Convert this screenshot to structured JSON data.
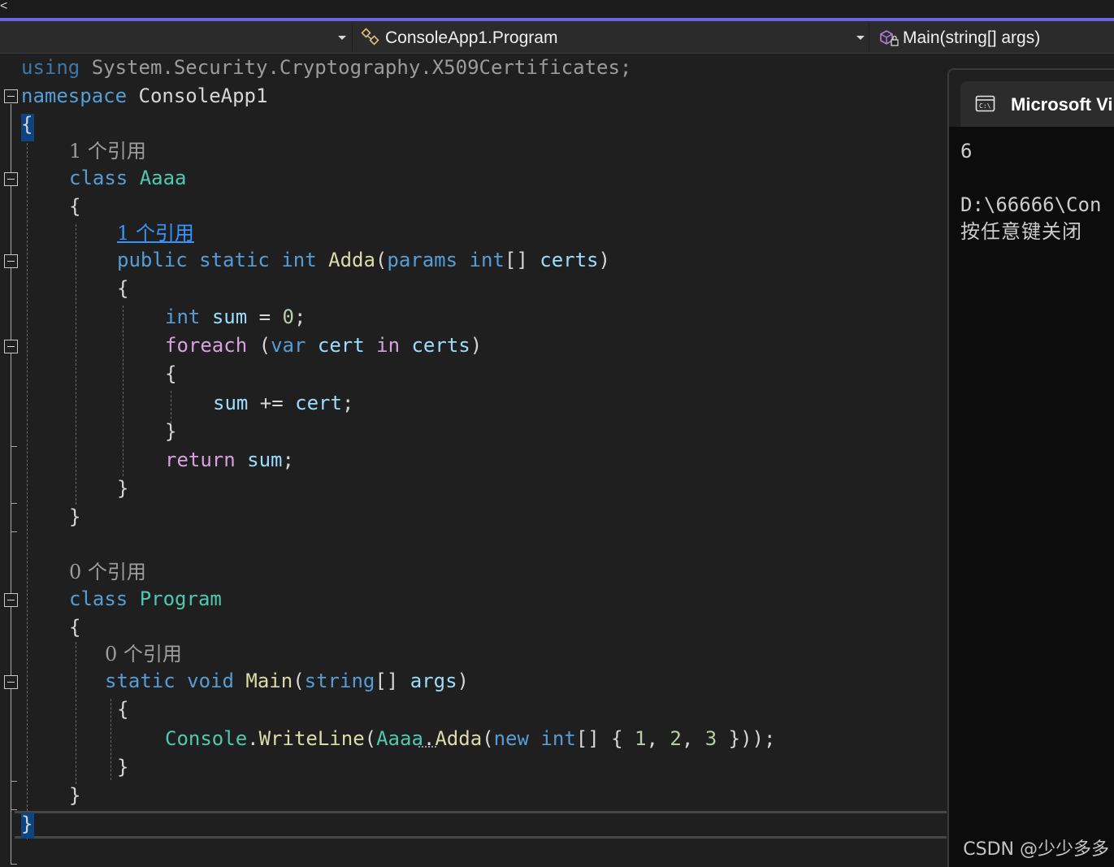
{
  "navbar": {
    "class_label": "ConsoleApp1.Program",
    "member_label": "Main(string[] args)"
  },
  "top_strip": {
    "chevron": "<"
  },
  "code": {
    "l1": {
      "using": "using",
      "ns": " System.Security.Cryptography.X509Certificates;"
    },
    "l2": {
      "kw": "namespace",
      "name": " ConsoleApp1"
    },
    "l3": "{",
    "lens1": "1 个引用",
    "l4": {
      "kw": "class",
      "name": "Aaaa"
    },
    "l5": "{",
    "lens2": "1 个引用",
    "l6": {
      "public": "public",
      "static": "static",
      "int": "int",
      "method": "Adda",
      "open": "(",
      "params": "params",
      "int2": "int",
      "brackets": "[] ",
      "arg": "certs",
      "close": ")"
    },
    "l7": "{",
    "l8": {
      "int": "int",
      "var": "sum",
      "rest": " = ",
      "num": "0",
      "semi": ";"
    },
    "l9": {
      "foreach": "foreach",
      "open": " (",
      "var": "var",
      "cert": "cert",
      "in": "in",
      "certs": "certs",
      "close": ")"
    },
    "l10": "{",
    "l11": {
      "sum": "sum",
      "op": " += ",
      "cert": "cert",
      "semi": ";"
    },
    "l12": "}",
    "l13": {
      "ret": "return",
      "sum": "sum",
      "semi": ";"
    },
    "l14": "}",
    "l15": "}",
    "lens3": "0 个引用",
    "l16": {
      "kw": "class",
      "name": "Program"
    },
    "l17": "{",
    "lens4": "0 个引用",
    "l18": {
      "static": "static",
      "void": "void",
      "method": "Main",
      "open": "(",
      "string": "string",
      "brackets": "[] ",
      "arg": "args",
      "close": ")"
    },
    "l19": "{",
    "l20": {
      "console": "Console",
      "dot": ".",
      "write": "WriteLine",
      "p1": "(",
      "aaaa": "Aaaa",
      "dot2": ".",
      "adda": "Adda",
      "p2": "(",
      "new": "new",
      "int": "int",
      "rest1": "[] { ",
      "n1": "1",
      "c1": ", ",
      "n2": "2",
      "c2": ", ",
      "n3": "3",
      "rest2": " }));"
    },
    "l21": "}",
    "l22": "}",
    "l23": "}"
  },
  "console": {
    "title": "Microsoft Vi",
    "output_line1": "6",
    "output_line2": "D:\\66666\\Con",
    "output_line3": "按任意键关闭"
  },
  "watermark": "CSDN @少少多多",
  "colors": {
    "accent": "#7160e8",
    "keyword": "#569cd6",
    "control": "#d8a0df",
    "type": "#4ec9b0",
    "method": "#dcdcaa",
    "param": "#9cdcfe",
    "number": "#b5cea8",
    "codelens_link": "#3794ff"
  }
}
